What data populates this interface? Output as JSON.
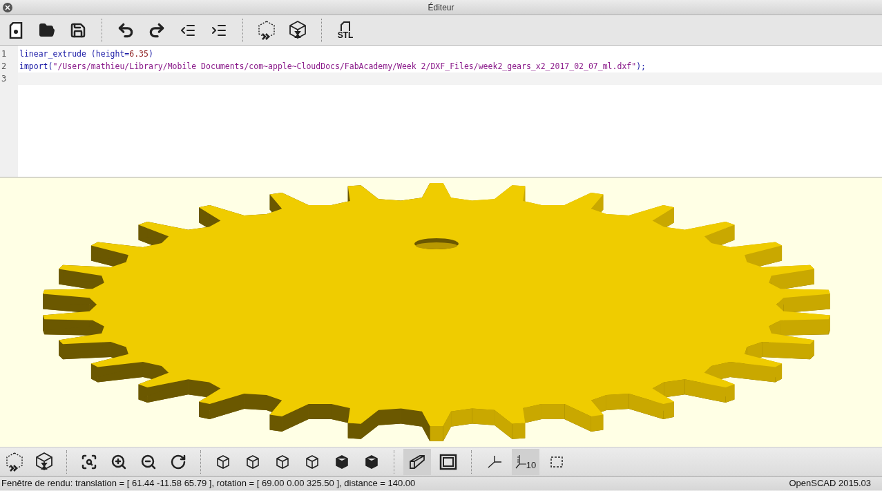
{
  "window": {
    "title": "Éditeur"
  },
  "main_toolbar": {
    "export_label": "STL"
  },
  "editor": {
    "lines": [
      {
        "number": "1",
        "current": false,
        "tokens": [
          {
            "kind": "keyword",
            "text": "linear_extrude"
          },
          {
            "kind": "plain",
            "text": " (height="
          },
          {
            "kind": "number",
            "text": "6.35"
          },
          {
            "kind": "plain",
            "text": ")"
          }
        ]
      },
      {
        "number": "2",
        "current": false,
        "tokens": [
          {
            "kind": "keyword",
            "text": "import"
          },
          {
            "kind": "plain",
            "text": "("
          },
          {
            "kind": "string",
            "text": "\"/Users/mathieu/Library/Mobile Documents/com~apple~CloudDocs/FabAcademy/Week 2/DXF_Files/week2_gears_x2_2017_02_07_ml.dxf\""
          },
          {
            "kind": "plain",
            "text": ");"
          }
        ]
      },
      {
        "number": "3",
        "current": true
      }
    ]
  },
  "view_toolbar": {
    "projection": [
      {
        "kind": "perspective",
        "selected": true
      },
      {
        "kind": "orthogonal",
        "selected": false
      }
    ],
    "display_toggles": [
      {
        "kind": "axes",
        "on": false
      },
      {
        "kind": "scales",
        "on": true,
        "label": "10"
      },
      {
        "kind": "crosshairs",
        "on": false
      }
    ]
  },
  "status_bar": {
    "message": "Fenêtre de rendu: translation = [ 61.44 -11.58 65.79 ], rotation = [ 69.00 0.00 325.50 ], distance = 140.00",
    "version": "OpenSCAD 2015.03"
  }
}
